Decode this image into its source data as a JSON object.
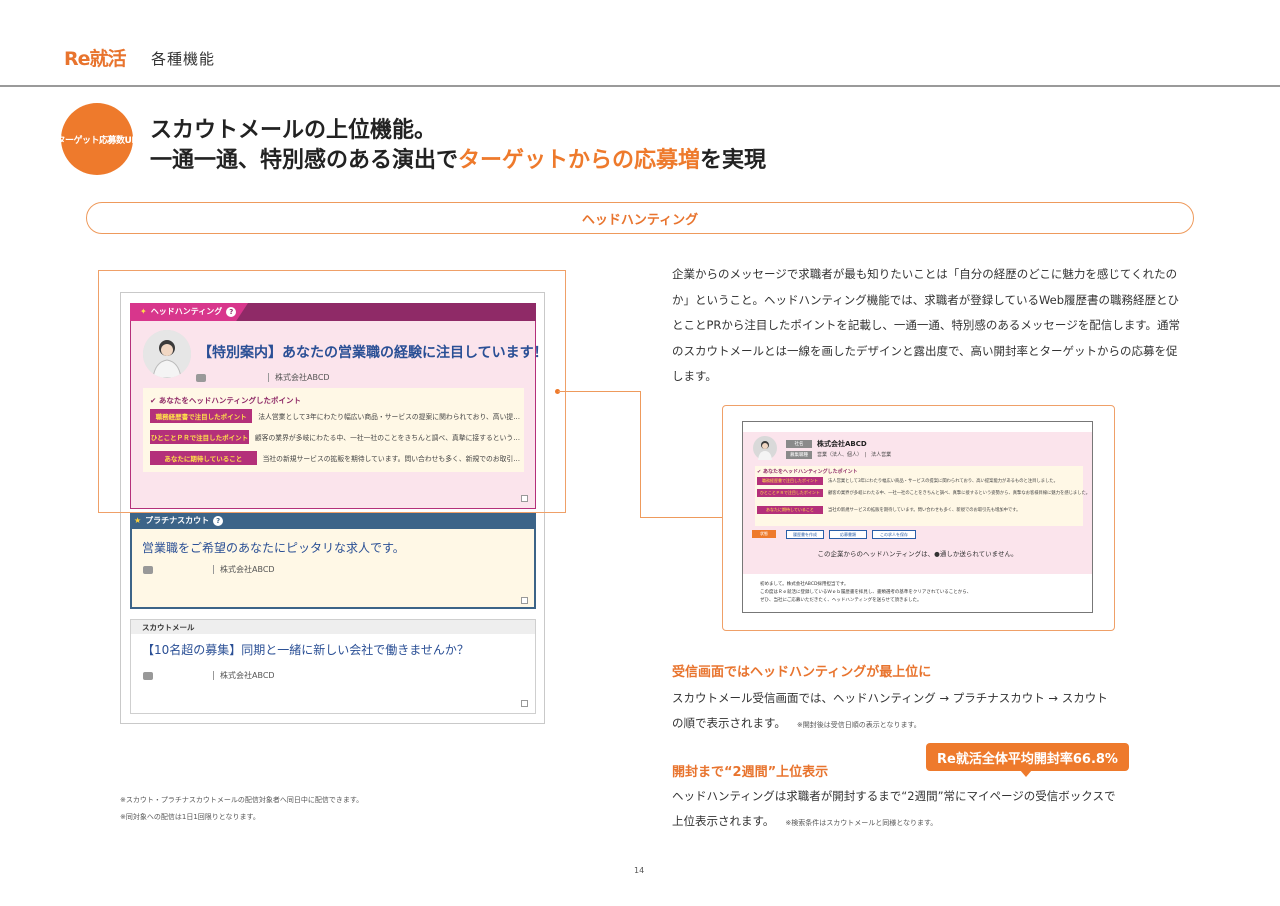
{
  "header": {
    "logo": "Re就活",
    "section": "各種機能"
  },
  "badge": {
    "label": "ターゲット応募数UP"
  },
  "headline": {
    "line1": "スカウトメールの上位機能。",
    "line2_prefix": "一通一通、特別感のある演出で",
    "line2_highlight": "ターゲットからの応募増",
    "line2_suffix": "を実現"
  },
  "pill_title": "ヘッドハンティング",
  "left_mock": {
    "headhunting": {
      "tab": "ヘッドハンティング",
      "help": "?",
      "title": "【特別案内】あなたの営業職の経験に注目しています！",
      "company": "株式会社ABCD",
      "points_title": "あなたをヘッドハンティングしたポイント",
      "points": [
        {
          "label": "職務経歴書で注目したポイント",
          "text": "法人営業として3年にわたり幅広い商品・サービスの提案に関わられており、高い提…"
        },
        {
          "label": "ひとことＰＲで注目したポイント",
          "text": "顧客の業界が多岐にわたる中、一社一社のことをきちんと調べ、真摯に接するという…"
        },
        {
          "label": "あなたに期待していること",
          "text": "当社の新規サービスの拡販を期待しています。問い合わせも多く、新規でのお取引…"
        }
      ]
    },
    "platinum": {
      "tab": "プラチナスカウト",
      "help": "?",
      "title": "営業職をご希望のあなたにピッタリな求人です。",
      "company": "株式会社ABCD"
    },
    "scout": {
      "tab": "スカウトメール",
      "title": "【10名超の募集】同期と一緒に新しい会社で働きませんか？",
      "company": "株式会社ABCD"
    }
  },
  "description": "企業からのメッセージで求職者が最も知りたいことは「自分の経歴のどこに魅力を感じてくれたのか」ということ。ヘッドハンティング機能では、求職者が登録しているWeb履歴書の職務経歴とひとことPRから注目したポイントを記載し、一通一通、特別感のあるメッセージを配信します。通常のスカウトメールとは一線を画したデザインと露出度で、高い開封率とターゲットからの応募を促します。",
  "right_mock": {
    "tag_company": "社名",
    "company": "株式会社ABCD",
    "tag_job": "募集職種",
    "job": "営業（法人、個人）　|　法人営業",
    "points_title": "あなたをヘッドハンティングしたポイント",
    "points": [
      {
        "label": "職務経歴書で注目したポイント",
        "text": "法人営業として3年にわたり幅広い商品・サービスの提案に関わられており、高い提案能力があるものと注目しました。"
      },
      {
        "label": "ひとことＰＲで注目したポイント",
        "text": "顧客の業界が多岐にわたる中、一社一社のことをきちんと調べ、真摯に接するという姿勢から、真摯なお客様目線に魅力を感じました。"
      },
      {
        "label": "あなたに期待していること",
        "text": "当社の新規サービスの拡販を期待しています。問い合わせも多く、新規でのお取引先も増加中です。"
      }
    ],
    "status_label": "状態",
    "buttons": [
      "履歴書を作成",
      "応募書類",
      "この求人を保存"
    ],
    "notice": "この企業からのヘッドハンティングは、●通しか送られていません。",
    "message": [
      "初めまして。株式会社ABCD採用担当です。",
      "この度はＲｅ就活に登録しているＷｅｂ履歴書を拝見し、書類選考の基準をクリアされていることから、",
      "ぜひ、当社にご応募いただきたく、ヘッドハンティングを送らせて頂きました。"
    ]
  },
  "section1": {
    "title": "受信画面ではヘッドハンティングが最上位に",
    "line1": "スカウトメール受信画面では、ヘッドハンティング → プラチナスカウト → スカウト",
    "line2": "の順で表示されます。",
    "note": "※開封後は受信日順の表示となります。"
  },
  "section2": {
    "title": "開封まで“2週間”上位表示",
    "callout": "Re就活全体平均開封率66.8%",
    "line1": "ヘッドハンティングは求職者が開封するまで“2週間”常にマイページの受信ボックスで",
    "line2": "上位表示されます。",
    "note": "※検索条件はスカウトメールと同様となります。"
  },
  "footnotes": [
    "※スカウト・プラチナスカウトメールの配信対象者へ同日中に配信できます。",
    "※同対象への配信は1日1回限りとなります。"
  ],
  "page_number": "14",
  "colors": {
    "accent": "#ee7a2c",
    "headhunting": "#8f2a67",
    "platinum": "#3c6488",
    "link_blue": "#2a4f95"
  }
}
